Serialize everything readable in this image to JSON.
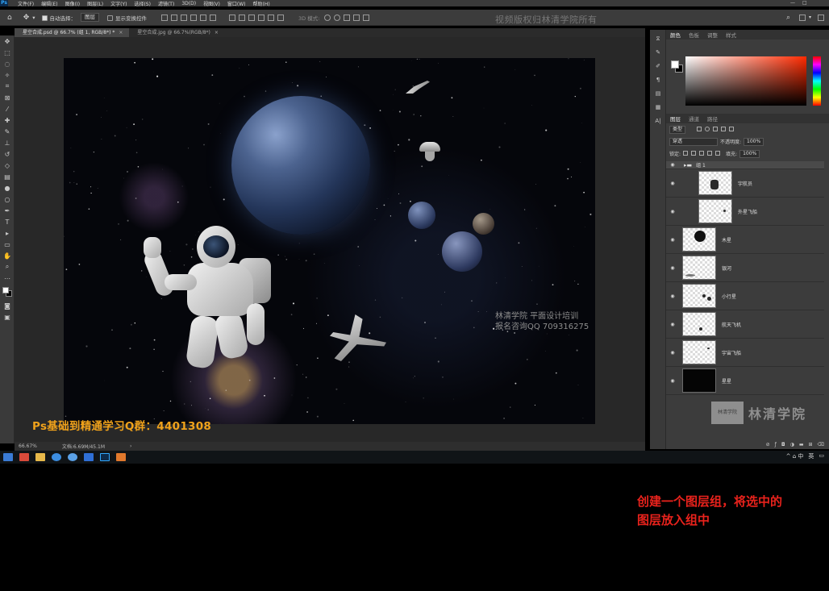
{
  "menubar": {
    "logo": "Ps",
    "items": [
      "文件(F)",
      "编辑(E)",
      "图像(I)",
      "图层(L)",
      "文字(Y)",
      "选择(S)",
      "滤镜(T)",
      "3D(D)",
      "视图(V)",
      "窗口(W)",
      "帮助(H)"
    ],
    "window_controls": [
      "—",
      "□"
    ]
  },
  "options_bar": {
    "auto_select_label": "自动选择：",
    "auto_select_target": "图层",
    "show_transform_label": "显示变换控件",
    "mode_3d_label": "3D 模式:"
  },
  "watermark_top": "视频版权归林清学院所有",
  "doc_tabs": [
    {
      "label": "星空合成.psd @ 66.7% (组 1, RGB/8*) *",
      "close": "×"
    },
    {
      "label": "星空合成.jpg @ 66.7%(RGB/8*)",
      "close": "×"
    }
  ],
  "canvas_watermark": {
    "line1": "林清学院  平面设计培训",
    "line2": "报名咨询QQ 709316275"
  },
  "promo_text": "Ps基础到精通学习Q群：4401308",
  "status_bar": {
    "zoom": "66.67%",
    "doc_size": "文档:6.69M/45.1M",
    "arrow": "›"
  },
  "color_panel": {
    "tabs": [
      "颜色",
      "色板",
      "调整",
      "样式"
    ]
  },
  "layers_panel": {
    "tabs": [
      "图层",
      "通道",
      "路径"
    ],
    "filter_kind": "类型",
    "blend_mode": "穿透",
    "opacity_label": "不透明度:",
    "opacity_value": "100%",
    "lock_label": "锁定:",
    "fill_label": "填充:",
    "fill_value": "100%",
    "group_name": "组 1",
    "layers": [
      {
        "name": "宇航员",
        "indent": true
      },
      {
        "name": "外星飞船",
        "indent": true
      },
      {
        "name": "木星",
        "indent": false
      },
      {
        "name": "银河",
        "indent": false
      },
      {
        "name": "小行星",
        "indent": false
      },
      {
        "name": "航天飞机",
        "indent": false
      },
      {
        "name": "宇宙飞船",
        "indent": false
      },
      {
        "name": "星星",
        "indent": false
      }
    ]
  },
  "panel_watermark": {
    "seal": "林清学院",
    "name": "林清学院"
  },
  "taskbar": {
    "ime": "英",
    "clock_icons": "^ ⌂ 中"
  },
  "caption": {
    "line1": "创建一个图层组，将选中的",
    "line2": "图层放入组中"
  },
  "colors": {
    "accent_orange": "#f0a21b",
    "caption_red": "#e8221c",
    "ps_blue": "#31a8ff"
  }
}
